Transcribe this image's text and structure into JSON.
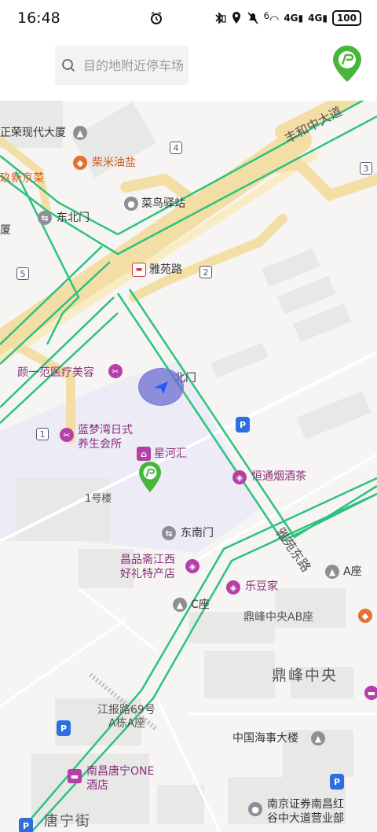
{
  "status_bar": {
    "time": "16:48",
    "battery": "100",
    "network_1": "4G",
    "network_2": "4G",
    "wifi": "6"
  },
  "search": {
    "placeholder": "目的地附近停车场"
  },
  "colors": {
    "route_green": "#2ec27e",
    "road_yellow": "#f3dfa6",
    "building_gray": "#e8e8e6",
    "campus_purple": "#ecebf6",
    "poi_purple": "#b53fa6",
    "location_blue": "#6c6cd0"
  },
  "icons": {
    "top_right": "parking-pin-icon",
    "location": "navigation-arrow-icon"
  },
  "map": {
    "roads": {
      "main_road": "丰和中大道",
      "side_road": "雅苑东路"
    },
    "labels": {
      "l1": "正荣现代大厦",
      "l2": "柴米油盐",
      "l3": "玖新京菜",
      "l4": "菜鸟驿站",
      "l5": "东北门",
      "l6": "厦",
      "l7": "雅苑路",
      "l8": "颜一范医疗美容",
      "l9": "北门",
      "l10": "蓝梦湾日式",
      "l10b": "养生会所",
      "l11": "星河汇",
      "l12": "恒通烟酒茶",
      "l13": "1号楼",
      "l14": "东南门",
      "l15": "昌品斋江西",
      "l15b": "好礼特产店",
      "l16": "乐豆家",
      "l17": "A座",
      "l18": "C座",
      "l19": "鼎峰中央AB座",
      "l20": "鼎峰中央",
      "l21": "江报路69号",
      "l21b": "A栋A座",
      "l22": "中国海事大楼",
      "l23": "南昌唐宁ONE",
      "l23b": "酒店",
      "l24": "南京证券南昌红",
      "l24b": "谷中大道营业部",
      "l25": "唐宁街"
    },
    "badges": {
      "b1": "4",
      "b2": "3",
      "b3": "5",
      "b4": "2",
      "b5": "1"
    }
  }
}
